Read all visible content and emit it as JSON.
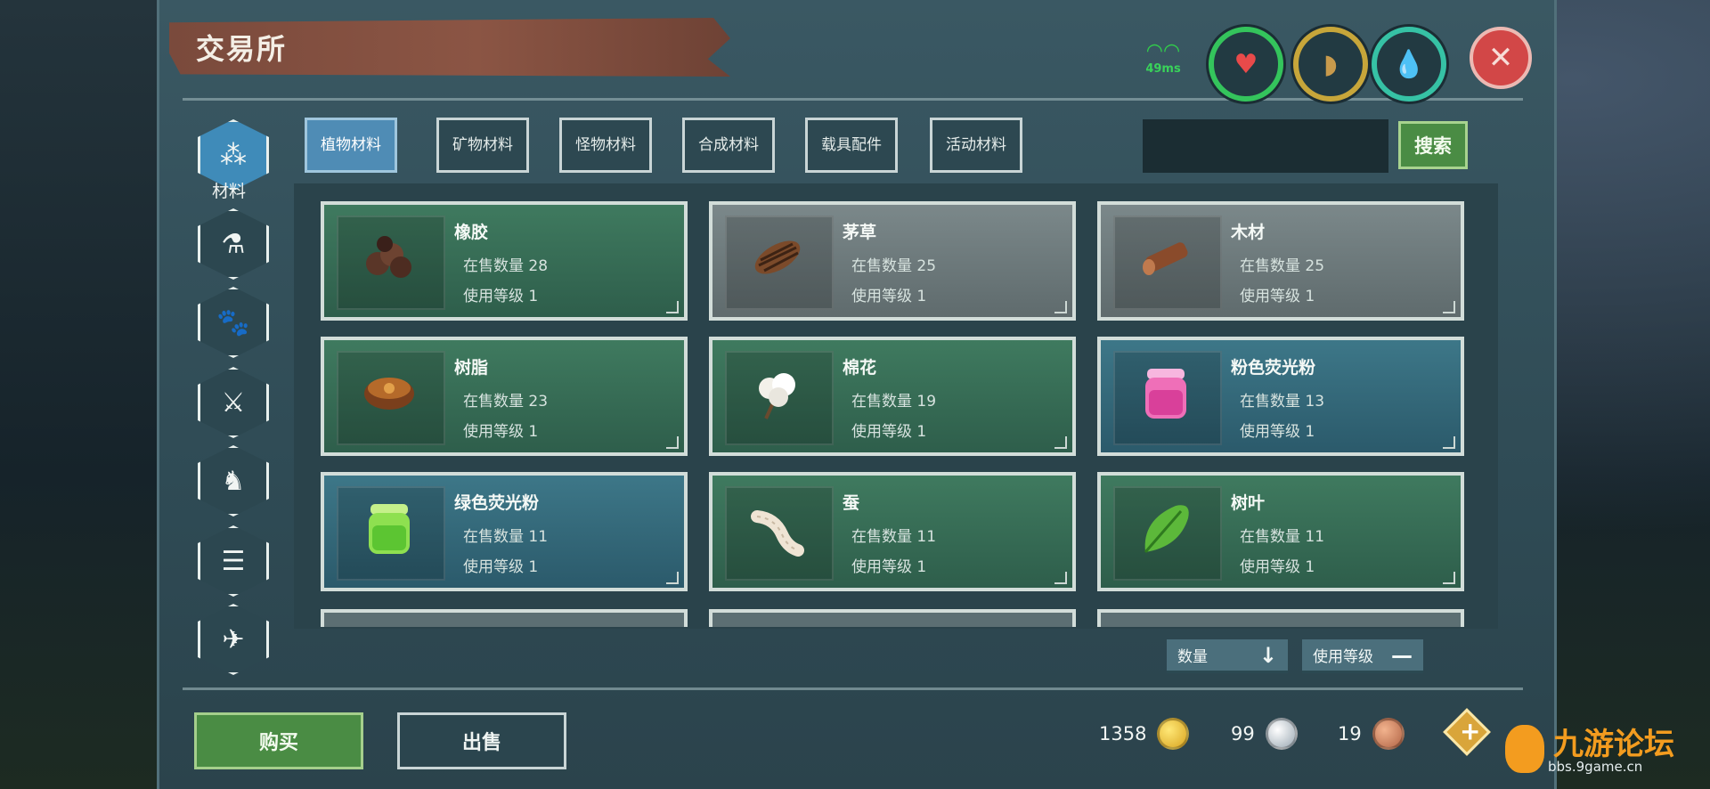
{
  "title": "交易所",
  "status": {
    "ping": "49ms"
  },
  "rail": {
    "active_label": "材料"
  },
  "tabs": [
    "植物材料",
    "矿物材料",
    "怪物材料",
    "合成材料",
    "载具配件",
    "活动材料"
  ],
  "search": {
    "button": "搜索",
    "value": ""
  },
  "items": [
    {
      "name": "橡胶",
      "count_label": "在售数量 28",
      "level_label": "使用等级 1",
      "color": "green"
    },
    {
      "name": "茅草",
      "count_label": "在售数量 25",
      "level_label": "使用等级 1",
      "color": "gray"
    },
    {
      "name": "木材",
      "count_label": "在售数量 25",
      "level_label": "使用等级 1",
      "color": "gray"
    },
    {
      "name": "树脂",
      "count_label": "在售数量 23",
      "level_label": "使用等级 1",
      "color": "green"
    },
    {
      "name": "棉花",
      "count_label": "在售数量 19",
      "level_label": "使用等级 1",
      "color": "green"
    },
    {
      "name": "粉色荧光粉",
      "count_label": "在售数量 13",
      "level_label": "使用等级 1",
      "color": "blue"
    },
    {
      "name": "绿色荧光粉",
      "count_label": "在售数量 11",
      "level_label": "使用等级 1",
      "color": "blue"
    },
    {
      "name": "蚕",
      "count_label": "在售数量 11",
      "level_label": "使用等级 1",
      "color": "green"
    },
    {
      "name": "树叶",
      "count_label": "在售数量 11",
      "level_label": "使用等级 1",
      "color": "green"
    }
  ],
  "sort": {
    "quantity": "数量",
    "level": "使用等级"
  },
  "actions": {
    "buy": "购买",
    "sell": "出售"
  },
  "currency": {
    "gold": "1358",
    "silver": "99",
    "copper": "19"
  },
  "watermark": {
    "brand": "九游论坛",
    "url": "bbs.9game.cn"
  }
}
